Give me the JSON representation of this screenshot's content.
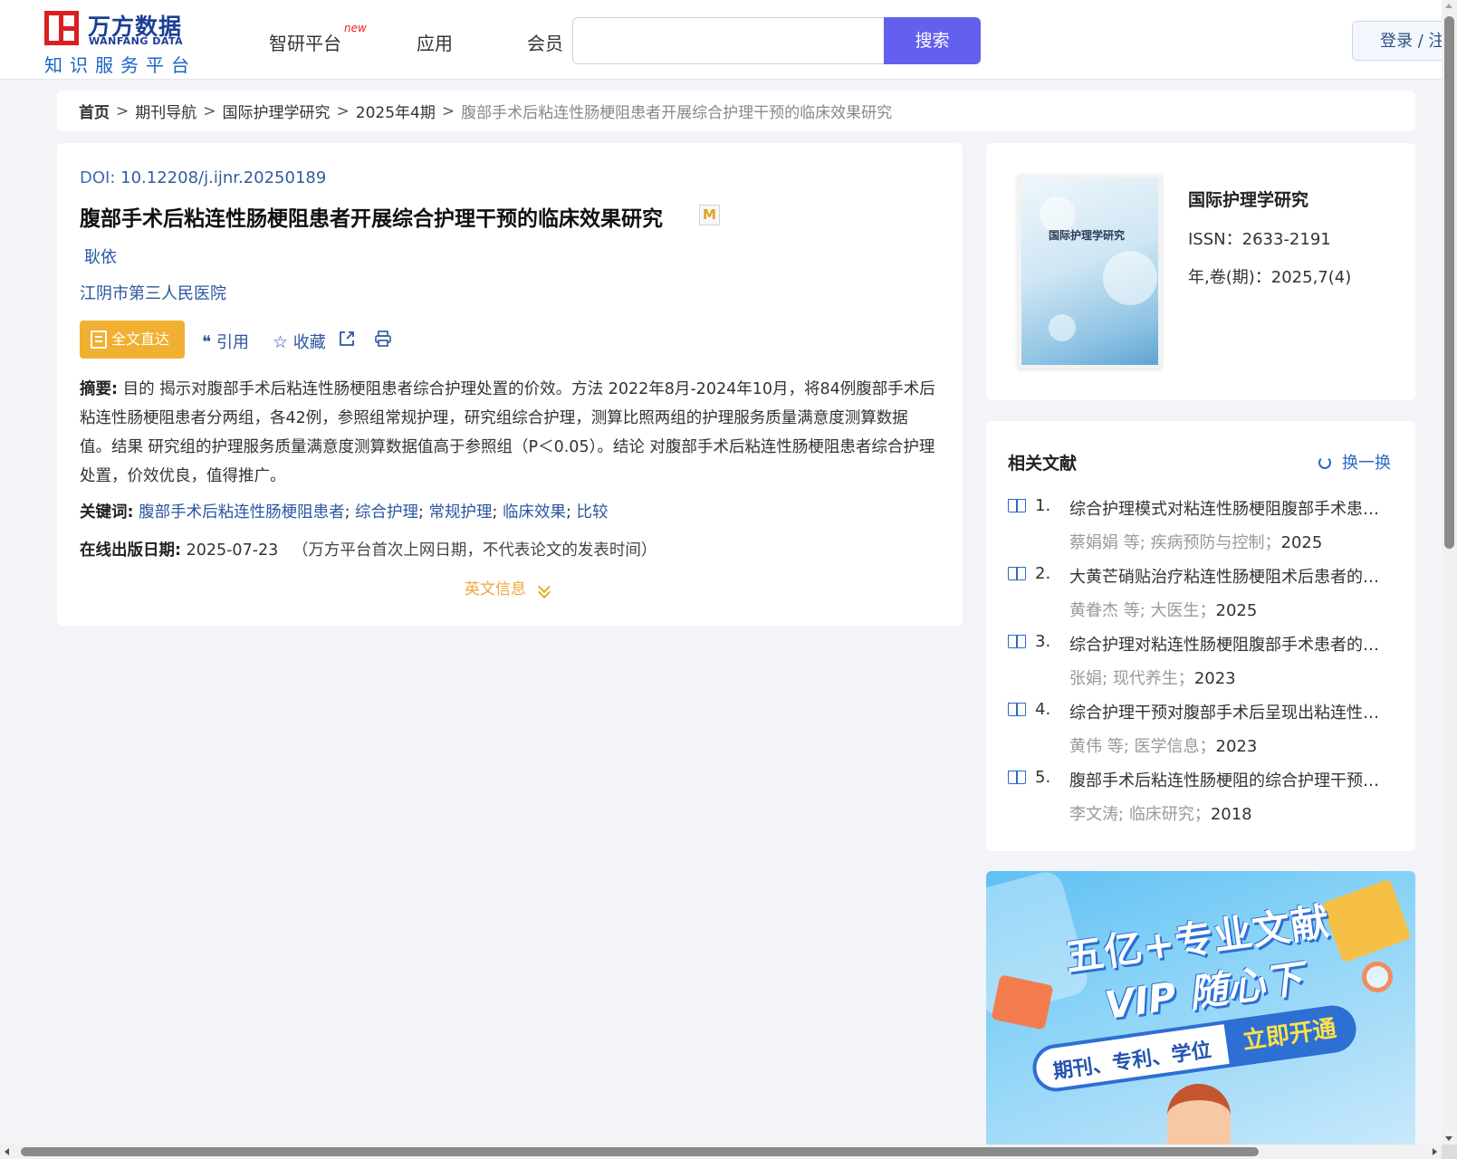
{
  "header": {
    "logo_cn": "万方数据",
    "logo_en": "WANFANG DATA",
    "logo_sub": "知识服务平台",
    "nav": [
      {
        "label": "智研平台",
        "badge": "new"
      },
      {
        "label": "应用"
      },
      {
        "label": "会员"
      }
    ],
    "search": {
      "value": "",
      "placeholder": "",
      "button": "搜索"
    },
    "login": "登录 / 注"
  },
  "breadcrumb": {
    "items": [
      "首页",
      "期刊导航",
      "国际护理学研究",
      "2025年4期"
    ],
    "separator": ">",
    "current": "腹部手术后粘连性肠梗阻患者开展综合护理干预的临床效果研究"
  },
  "article": {
    "doi_label": "DOI:",
    "doi": "10.12208/j.ijnr.20250189",
    "title": "腹部手术后粘连性肠梗阻患者开展综合护理干预的临床效果研究",
    "m_badge": "M",
    "author": "耿依",
    "org": "江阴市第三人民医院",
    "actions": {
      "fulltext": "全文直达",
      "cite": "引用",
      "collect": "收藏"
    },
    "abstract_label": "摘要:",
    "abstract": "目的 揭示对腹部手术后粘连性肠梗阻患者综合护理处置的价效。方法 2022年8月-2024年10月，将84例腹部手术后粘连性肠梗阻患者分两组，各42例，参照组常规护理，研究组综合护理，测算比照两组的护理服务质量满意度测算数据值。结果 研究组的护理服务质量满意度测算数据值高于参照组（P＜0.05）。结论 对腹部手术后粘连性肠梗阻患者综合护理处置，价效优良，值得推广。",
    "keywords_label": "关键词:",
    "keywords": [
      "腹部手术后粘连性肠梗阻患者",
      "综合护理",
      "常规护理",
      "临床效果",
      "比较"
    ],
    "pubdate_label": "在线出版日期:",
    "pubdate": "2025-07-23",
    "pubdate_note": "（万方平台首次上网日期，不代表论文的发表时间）",
    "en_info": "英文信息"
  },
  "journal": {
    "cover_title": "国际护理学研究",
    "name": "国际护理学研究",
    "issn": "ISSN：2633-2191",
    "volume": "年,卷(期)：2025,7(4)"
  },
  "related": {
    "heading": "相关文献",
    "refresh": "换一换",
    "items": [
      {
        "num": "1.",
        "title": "综合护理模式对粘连性肠梗阻腹部手术患者...",
        "authors": "蔡娟娟 等;",
        "source": "疾病预防与控制；",
        "year": "2025"
      },
      {
        "num": "2.",
        "title": "大黄芒硝贴治疗粘连性肠梗阻术后患者的效...",
        "authors": "黄眷杰 等;",
        "source": "大医生；",
        "year": "2025"
      },
      {
        "num": "3.",
        "title": "综合护理对粘连性肠梗阻腹部手术患者的干...",
        "authors": "张娟;",
        "source": "现代养生；",
        "year": "2023"
      },
      {
        "num": "4.",
        "title": "综合护理干预对腹部手术后呈现出粘连性肠...",
        "authors": "黄伟 等;",
        "source": "医学信息；",
        "year": "2023"
      },
      {
        "num": "5.",
        "title": "腹部手术后粘连性肠梗阻的综合护理干预效...",
        "authors": "李文涛;",
        "source": "临床研究；",
        "year": "2018"
      }
    ]
  },
  "promo": {
    "line1": "五亿+专业文献",
    "line2": "VIP 随心下",
    "pill_left": "期刊、专利、学位",
    "pill_right": "立即开通"
  }
}
